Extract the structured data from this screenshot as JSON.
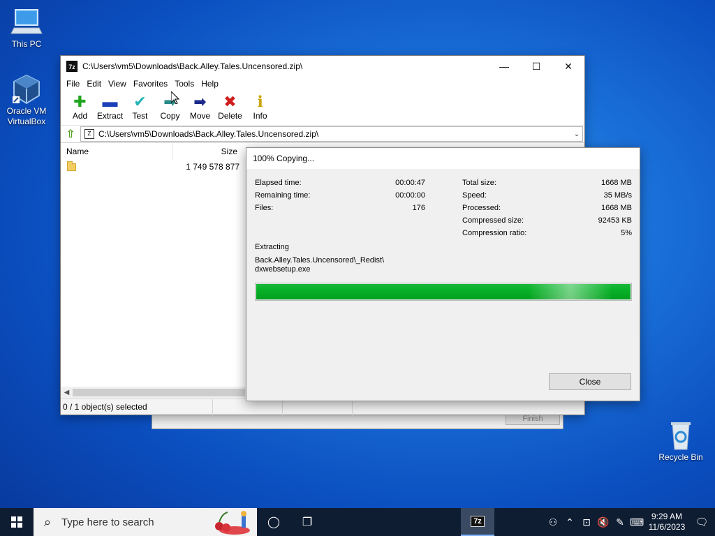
{
  "desktop": {
    "icons": [
      {
        "label": "This PC"
      },
      {
        "label": "Oracle VM VirtualBox"
      },
      {
        "label": "Recycle Bin"
      }
    ]
  },
  "window": {
    "title": "C:\\Users\\vm5\\Downloads\\Back.Alley.Tales.Uncensored.zip\\",
    "app_icon": "7z",
    "controls": {
      "minimize": "—",
      "maximize": "☐",
      "close": "✕"
    },
    "menu": [
      "File",
      "Edit",
      "View",
      "Favorites",
      "Tools",
      "Help"
    ],
    "toolbar": [
      {
        "label": "Add",
        "icon": "plus-icon",
        "glyph": "✚",
        "color": "#1fa51f"
      },
      {
        "label": "Extract",
        "icon": "minus-icon",
        "glyph": "▬",
        "color": "#1a3fb8"
      },
      {
        "label": "Test",
        "icon": "check-icon",
        "glyph": "✔",
        "color": "#27b5b5"
      },
      {
        "label": "Copy",
        "icon": "copy-arrow-icon",
        "glyph": "➡",
        "color": "#2a8a8a"
      },
      {
        "label": "Move",
        "icon": "move-arrow-icon",
        "glyph": "➡",
        "color": "#1a2a8c"
      },
      {
        "label": "Delete",
        "icon": "delete-x-icon",
        "glyph": "✖",
        "color": "#d01c1c"
      },
      {
        "label": "Info",
        "icon": "info-icon",
        "glyph": "ℹ",
        "color": "#c9a400"
      }
    ],
    "address": "C:\\Users\\vm5\\Downloads\\Back.Alley.Tales.Uncensored.zip\\",
    "columns": {
      "name": "Name",
      "size": "Size"
    },
    "rows": [
      {
        "name": "",
        "size": "1 749 578 877"
      }
    ],
    "status": "0 / 1 object(s) selected"
  },
  "behind_dialog": {
    "finish_label": "Finish"
  },
  "progress": {
    "title": "100% Copying...",
    "percent": 100,
    "left_stats": [
      {
        "label": "Elapsed time:",
        "value": "00:00:47"
      },
      {
        "label": "Remaining time:",
        "value": "00:00:00"
      },
      {
        "label": "Files:",
        "value": "176"
      }
    ],
    "right_stats": [
      {
        "label": "Total size:",
        "value": "1668 MB"
      },
      {
        "label": "Speed:",
        "value": "35 MB/s"
      },
      {
        "label": "Processed:",
        "value": "1668 MB"
      },
      {
        "label": "Compressed size:",
        "value": "92453 KB"
      },
      {
        "label": "Compression ratio:",
        "value": "5%"
      }
    ],
    "action": "Extracting",
    "file_line1": "Back.Alley.Tales.Uncensored\\_Redist\\",
    "file_line2": "dxwebsetup.exe",
    "close_label": "Close",
    "bar_color": "#06b025"
  },
  "taskbar": {
    "search_placeholder": "Type here to search",
    "app_7z": "7z",
    "time": "9:29 AM",
    "date": "11/6/2023"
  }
}
